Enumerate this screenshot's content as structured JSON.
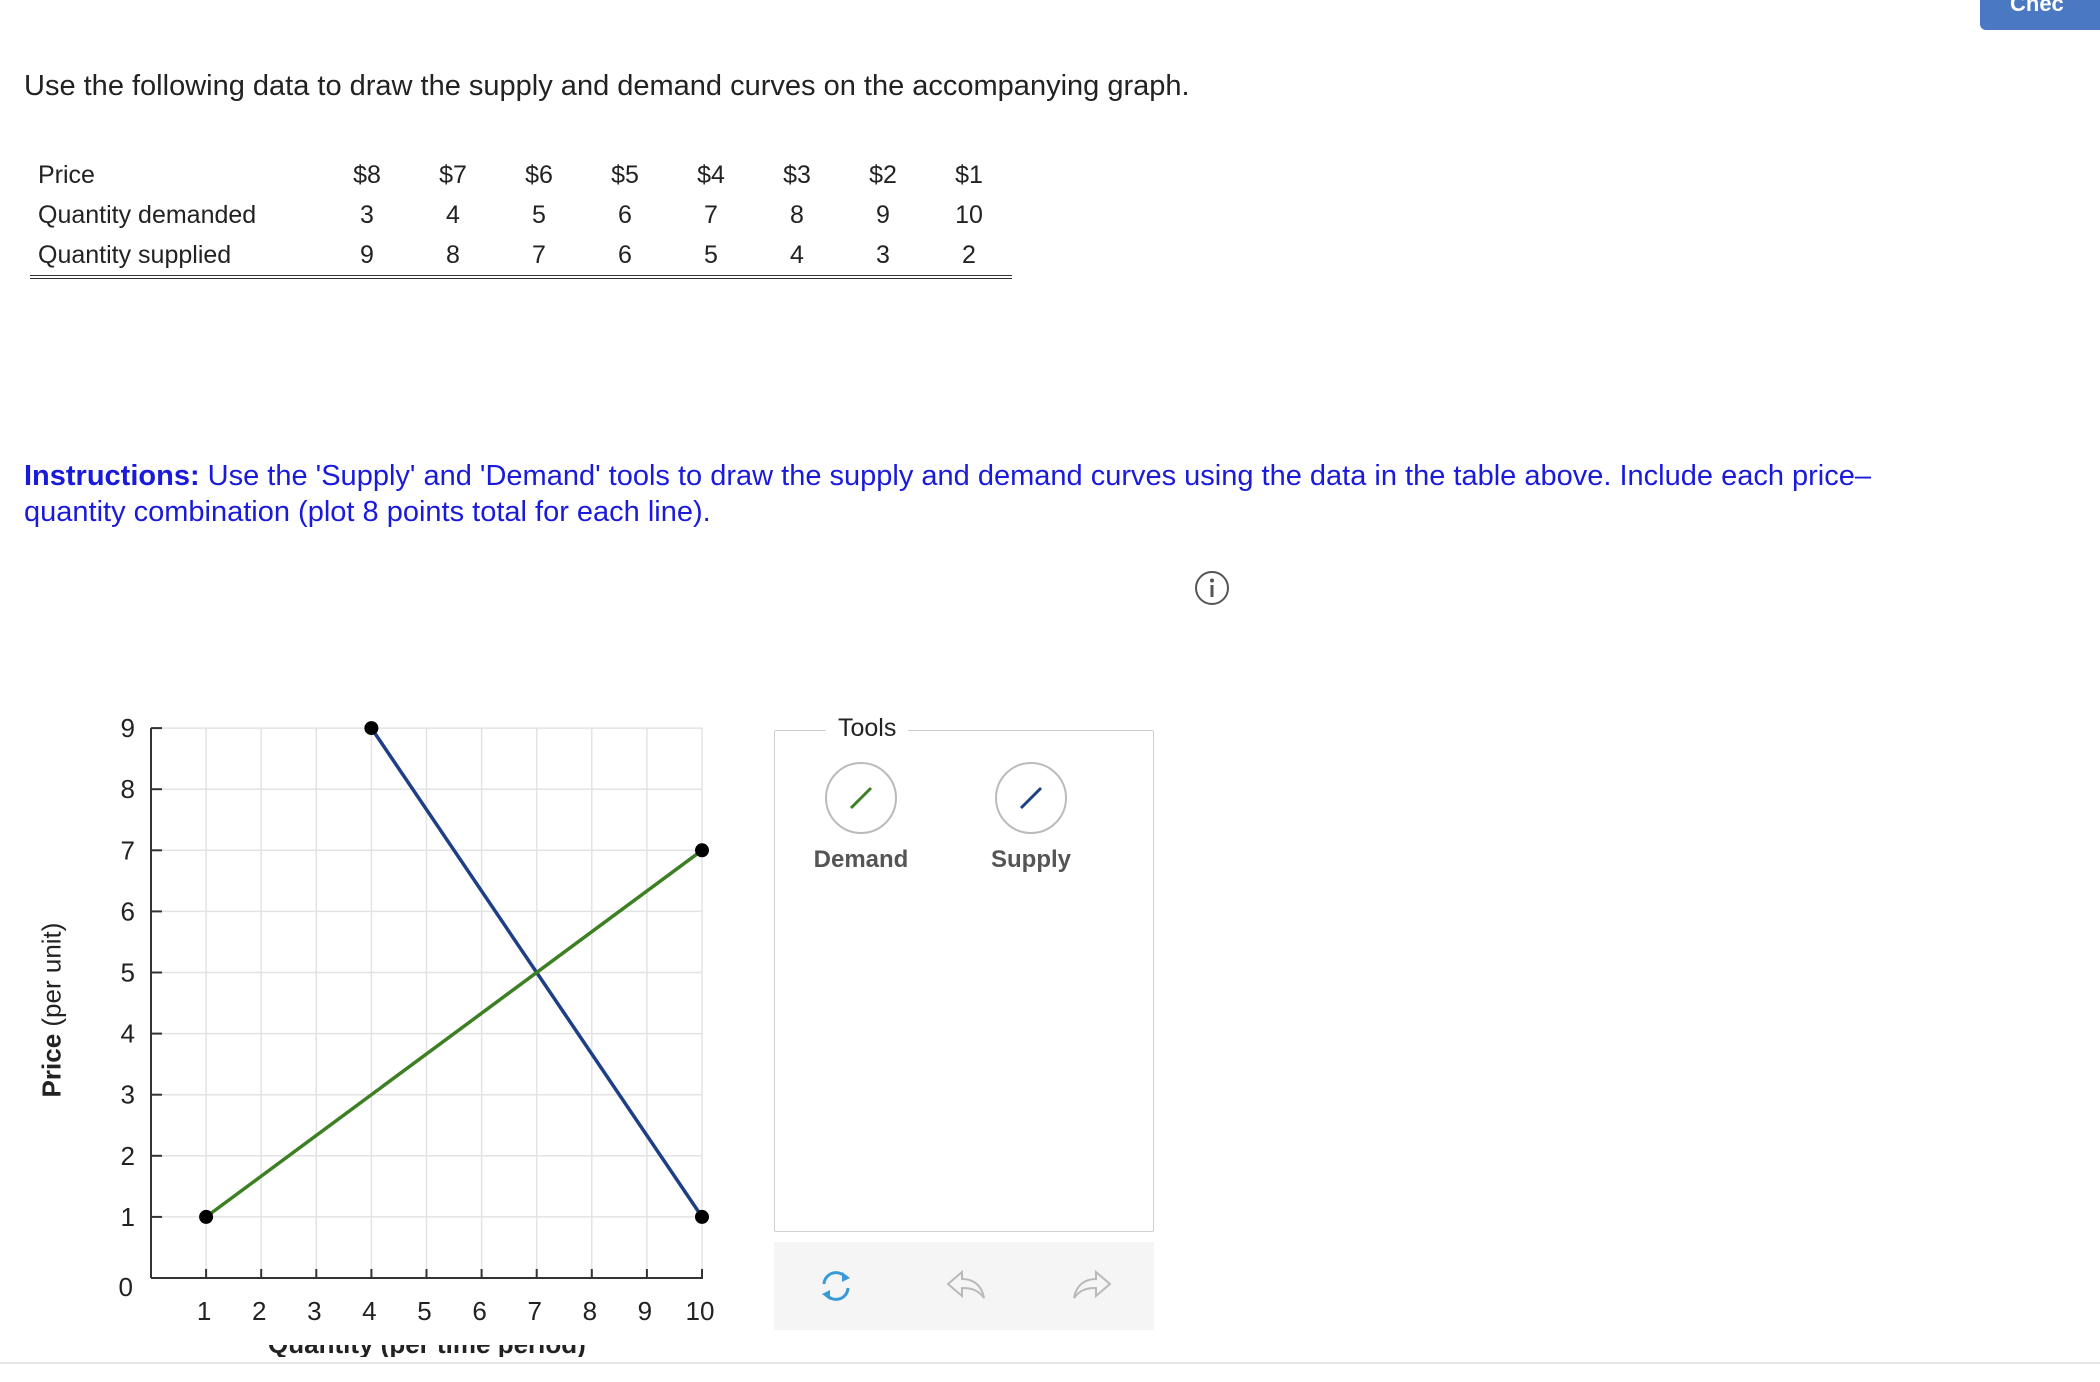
{
  "header": {
    "check_label": "Chec"
  },
  "intro_text": "Use the following data to draw the supply and demand curves on the accompanying graph.",
  "table": {
    "rows": [
      {
        "label": "Price",
        "values": [
          "$8",
          "$7",
          "$6",
          "$5",
          "$4",
          "$3",
          "$2",
          "$1"
        ]
      },
      {
        "label": "Quantity demanded",
        "values": [
          "3",
          "4",
          "5",
          "6",
          "7",
          "8",
          "9",
          "10"
        ]
      },
      {
        "label": "Quantity supplied",
        "values": [
          "9",
          "8",
          "7",
          "6",
          "5",
          "4",
          "3",
          "2"
        ]
      }
    ]
  },
  "instructions": {
    "bold": "Instructions:",
    "text": " Use the 'Supply' and 'Demand' tools to draw the supply and demand curves using the data in the table above. Include each price–quantity combination (plot 8 points total for each line)."
  },
  "graph": {
    "ylabel_bold": "Price",
    "ylabel_rest": " (per unit)",
    "xlabel": "Quantity (per time period)"
  },
  "tools": {
    "title": "Tools",
    "demand_label": "Demand",
    "supply_label": "Supply"
  },
  "colors": {
    "demand": "#3d7f23",
    "supply": "#1c3f86",
    "instructions": "#1a1adb",
    "check_button": "#4a78c2"
  },
  "chart_data": {
    "type": "line",
    "xlim": [
      0,
      10
    ],
    "ylim": [
      0,
      9
    ],
    "x_ticks": [
      "1",
      "2",
      "3",
      "4",
      "5",
      "6",
      "7",
      "8",
      "9",
      "10"
    ],
    "y_ticks": [
      "1",
      "2",
      "3",
      "4",
      "5",
      "6",
      "7",
      "8",
      "9"
    ],
    "origin_label": "0",
    "grid": true,
    "series": [
      {
        "color": "#1c3f86",
        "points": [
          [
            4,
            9
          ],
          [
            10,
            1
          ]
        ]
      },
      {
        "color": "#3d7f23",
        "points": [
          [
            1,
            1
          ],
          [
            10,
            7
          ]
        ]
      }
    ]
  }
}
